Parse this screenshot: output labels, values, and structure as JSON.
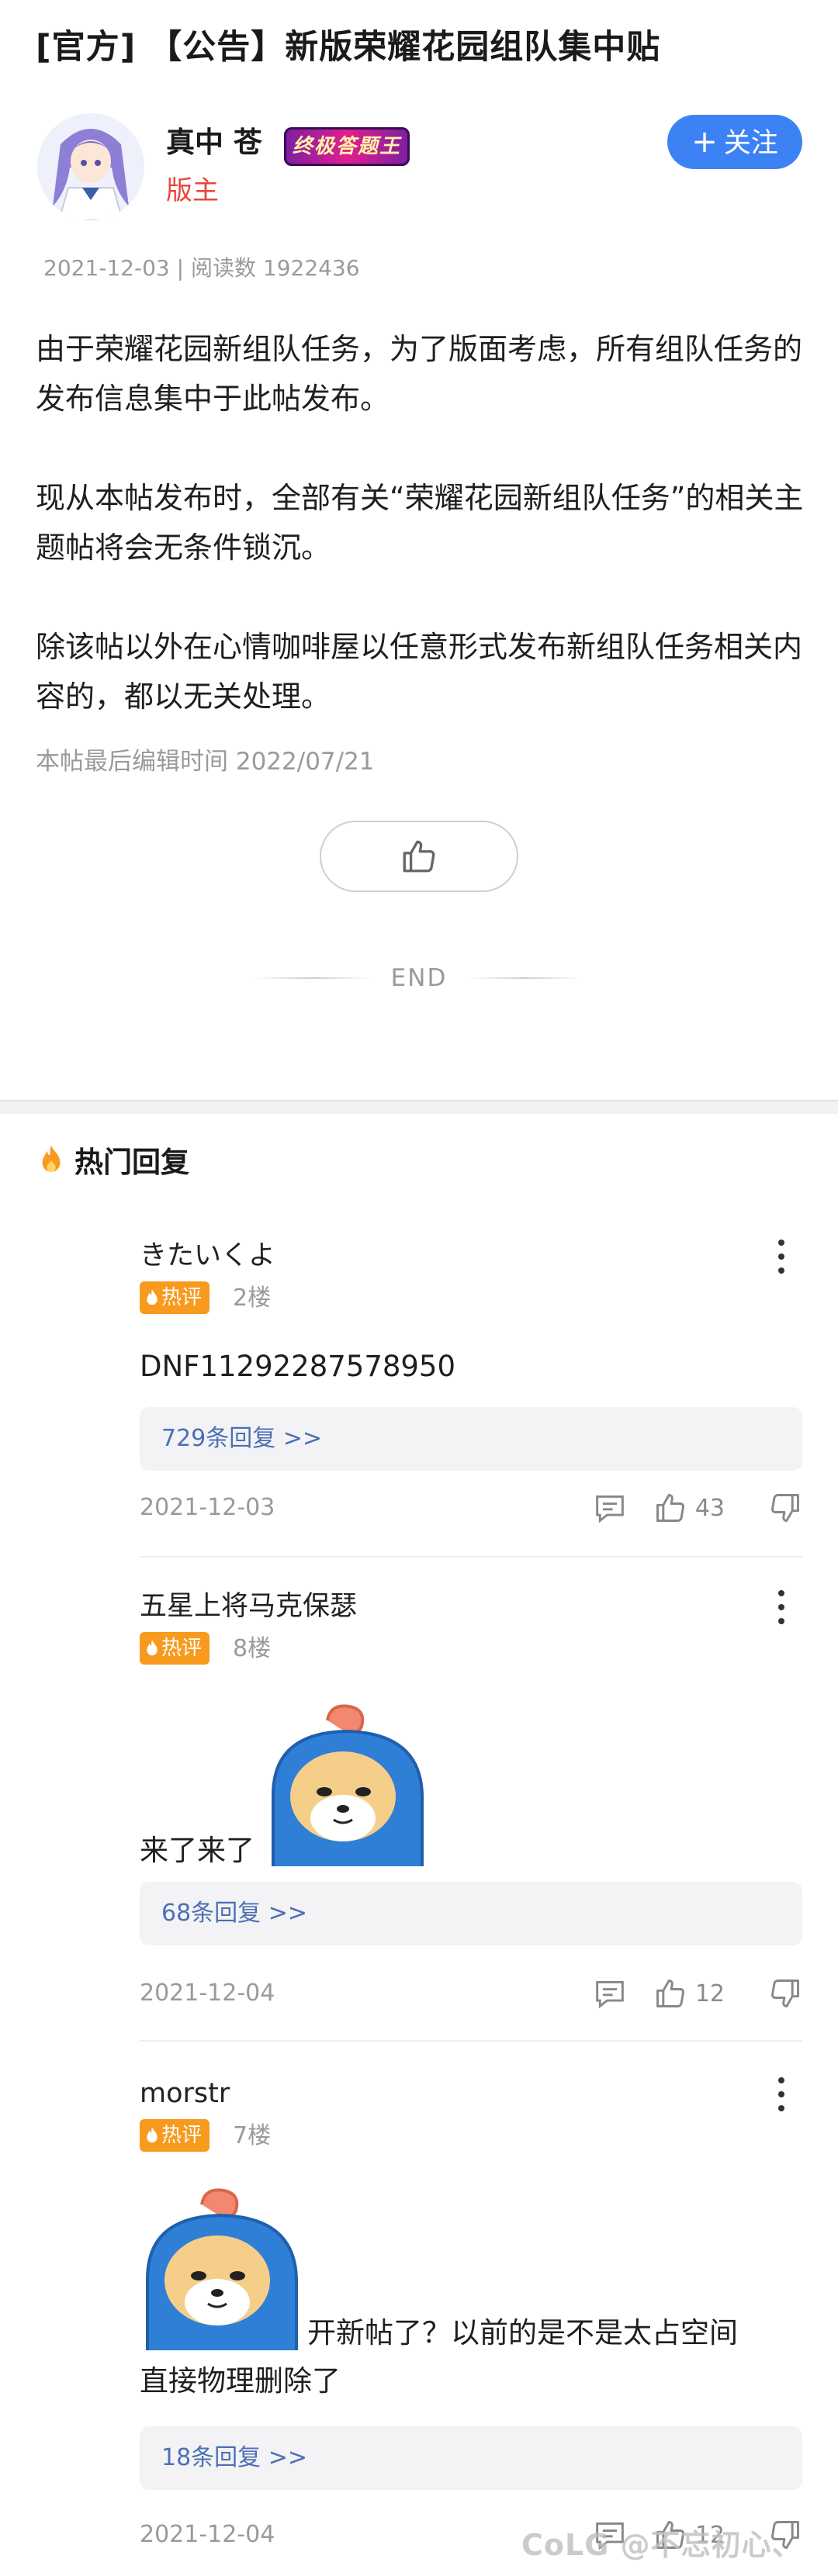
{
  "post": {
    "title": "[官方] 【公告】新版荣耀花园组队集中贴",
    "author": {
      "name": "真中 苍",
      "badge": "终极答题王",
      "role": "版主"
    },
    "follow_label": "关注",
    "date": "2021-12-03",
    "read_count": "阅读数 1922436",
    "paragraphs": [
      "由于荣耀花园新组队任务，为了版面考虑，所有组队任务的发布信息集中于此帖发布。",
      "现从本帖发布时，全部有关“荣耀花园新组队任务”的相关主题帖将会无条件锁沉。",
      "除该帖以外在心情咖啡屋以任意形式发布新组队任务相关内容的，都以无关处理。"
    ],
    "edit_time": "本帖最后编辑时间 2022/07/21",
    "end_label": "END"
  },
  "hot_replies": {
    "title": "热门回复",
    "hot_badge": "热评",
    "comments": [
      {
        "user": "きたいくよ",
        "floor": "2楼",
        "text": "DNF11292287578950",
        "replies": "729条回复 >>",
        "date": "2021-12-03",
        "likes": "43"
      },
      {
        "user": "五星上将马克保瑟",
        "floor": "8楼",
        "text": "来了来了",
        "replies": "68条回复 >>",
        "date": "2021-12-04",
        "likes": "12"
      },
      {
        "user": "morstr",
        "floor": "7楼",
        "text": "开新帖了？以前的是不是太占空间",
        "text2": "直接物理删除了",
        "replies": "18条回复 >>",
        "date": "2021-12-04",
        "likes": "12"
      }
    ]
  },
  "watermark": "CoLG @不忘初心、",
  "colors": {
    "accent": "#3d82f4",
    "hot": "#f79a1e",
    "role": "#e8453c",
    "link": "#4c6fb5"
  }
}
